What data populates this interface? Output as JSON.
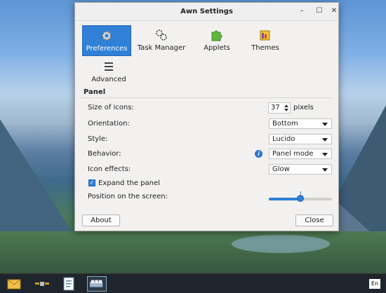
{
  "window": {
    "title": "Awn Settings",
    "controls": {
      "minimize": "–",
      "maximize": "☐",
      "close": "✕"
    }
  },
  "tabs": [
    {
      "label": "Preferences",
      "icon": "gear-icon",
      "selected": true
    },
    {
      "label": "Task Manager",
      "icon": "cogs-icon",
      "selected": false
    },
    {
      "label": "Applets",
      "icon": "puzzle-icon",
      "selected": false
    },
    {
      "label": "Themes",
      "icon": "themes-icon",
      "selected": false
    },
    {
      "label": "Advanced",
      "icon": "menu-icon",
      "selected": false
    }
  ],
  "panel": {
    "section_title": "Panel",
    "size_of_icons": {
      "label": "Size of icons:",
      "value": "37",
      "unit": "pixels"
    },
    "orientation": {
      "label": "Orientation:",
      "value": "Bottom"
    },
    "style": {
      "label": "Style:",
      "value": "Lucido"
    },
    "behavior": {
      "label": "Behavior:",
      "value": "Panel mode",
      "info_icon": "info-icon"
    },
    "icon_effects": {
      "label": "Icon effects:",
      "value": "Glow"
    },
    "expand_panel": {
      "label": "Expand the panel",
      "checked": true
    },
    "position": {
      "label": "Position on the screen:",
      "value": 0.5
    }
  },
  "buttons": {
    "about": "About",
    "close": "Close"
  },
  "taskbar": {
    "items": [
      "mail-icon",
      "satellite-icon",
      "document-icon",
      "awn-settings-icon"
    ],
    "language": "En"
  },
  "colors": {
    "accent": "#2f80d6"
  }
}
